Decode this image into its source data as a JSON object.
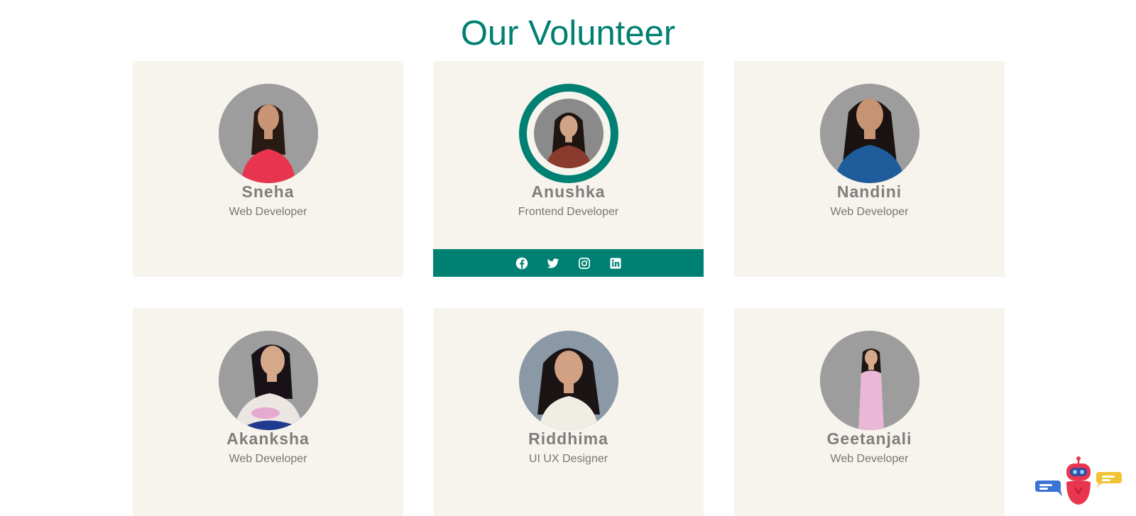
{
  "section": {
    "title": "Our Volunteer"
  },
  "volunteers": [
    {
      "name": "Sneha",
      "role": "Web Developer",
      "shirt_color": "#e8344e",
      "hair_color": "#2a1a14",
      "bg_color": "#9d9d9d"
    },
    {
      "name": "Anushka",
      "role": "Frontend Developer",
      "shirt_color": "#8b3a2e",
      "hair_color": "#1e1410",
      "bg_color": "#8a8a8a"
    },
    {
      "name": "Nandini",
      "role": "Web Developer",
      "shirt_color": "#1f5c9c",
      "hair_color": "#1a1210",
      "bg_color": "#9d9d9d"
    },
    {
      "name": "Akanksha",
      "role": "Web Developer",
      "shirt_color": "#ece6e2",
      "hair_color": "#181218",
      "bg_color": "#9d9d9d"
    },
    {
      "name": "Riddhima",
      "role": "UI UX Designer",
      "shirt_color": "#efede4",
      "hair_color": "#1a1414",
      "bg_color": "#8b98a6"
    },
    {
      "name": "Geetanjali",
      "role": "Web Developer",
      "shirt_color": "#e9b8d6",
      "hair_color": "#1d1612",
      "bg_color": "#9d9d9d"
    }
  ],
  "social_icons": [
    "facebook-icon",
    "twitter-icon",
    "instagram-icon",
    "linkedin-icon"
  ],
  "colors": {
    "accent": "#008072",
    "card_bg": "#f6f4ec",
    "name_text": "#7e7e7e",
    "role_text": "#767676"
  },
  "chatbot": {
    "icon": "robot-chat-icon"
  }
}
